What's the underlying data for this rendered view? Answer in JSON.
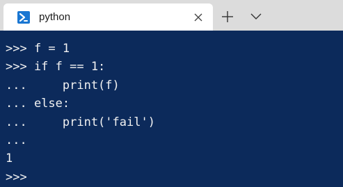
{
  "tab": {
    "title": "python",
    "icon": "powershell-icon",
    "close_icon": "close-icon"
  },
  "toolbar": {
    "new_tab_icon": "plus-icon",
    "dropdown_icon": "chevron-down-icon"
  },
  "colors": {
    "terminal_bg": "#0c2a5b",
    "tabbar_bg": "#dcdcdc",
    "text": "#f2f2f2",
    "icon_accent": "#1976d2"
  },
  "terminal": {
    "lines": [
      ">>> f = 1",
      ">>> if f == 1:",
      "...     print(f)",
      "... else:",
      "...     print('fail')",
      "...",
      "1",
      ">>>"
    ]
  }
}
